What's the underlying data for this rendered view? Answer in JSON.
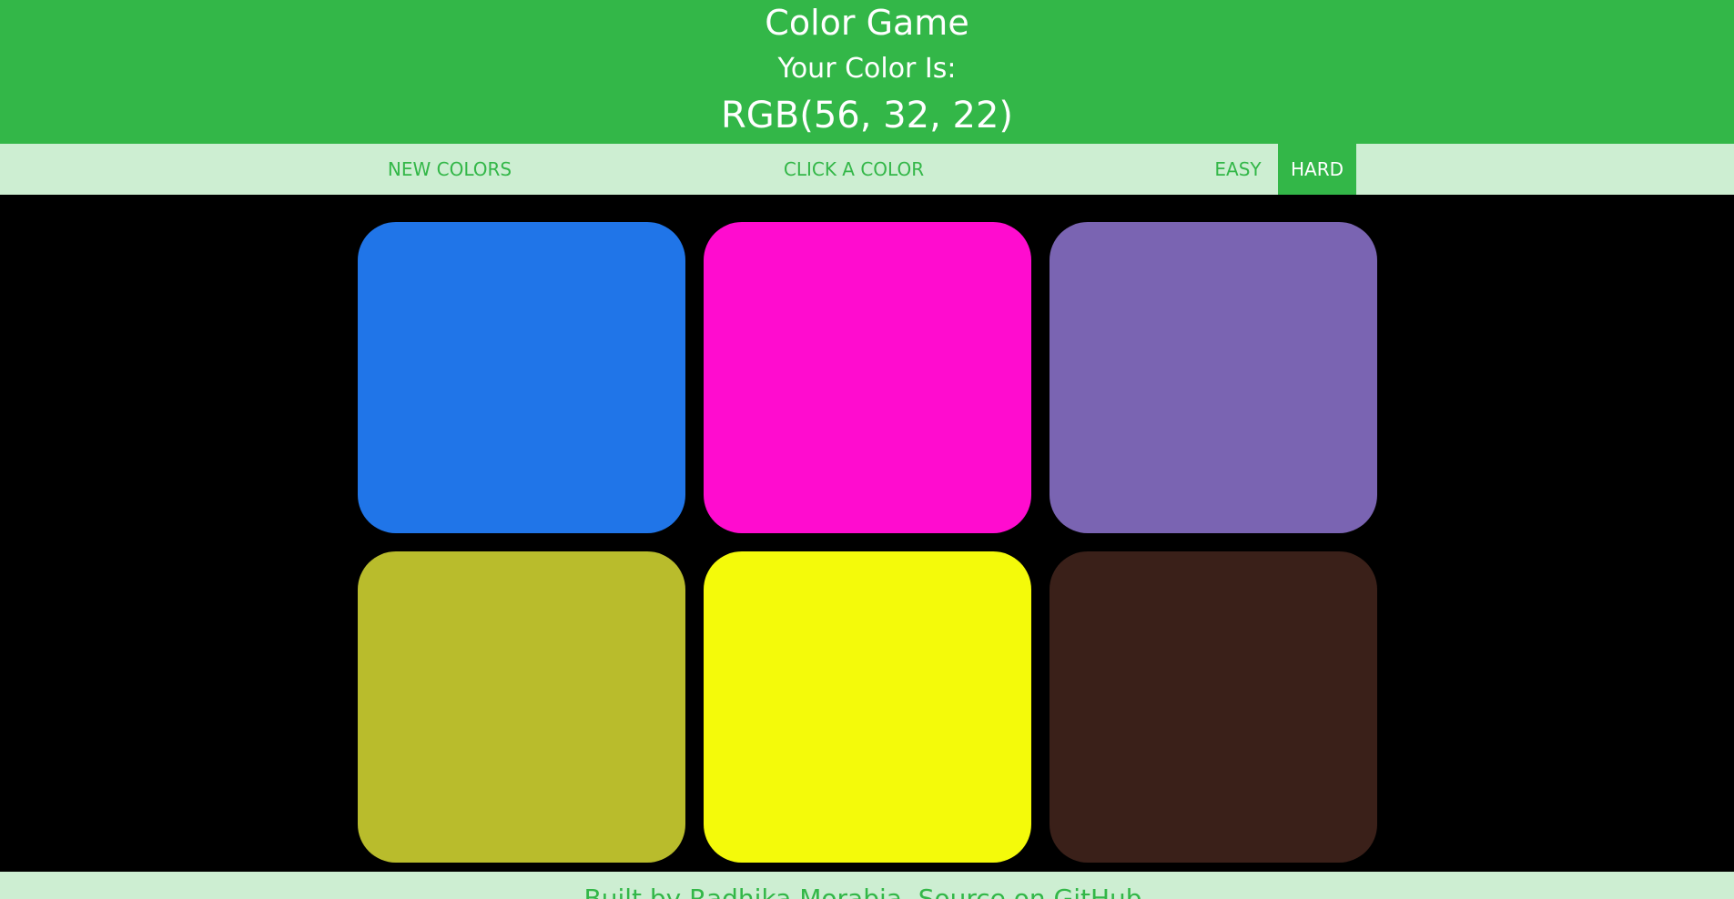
{
  "header": {
    "title": "Color Game",
    "subtitle": "Your Color Is:",
    "target_color": "RGB(56, 32, 22)"
  },
  "menu": {
    "new_colors_label": "NEW COLORS",
    "message": "CLICK A COLOR",
    "easy_label": "EASY",
    "hard_label": "HARD",
    "selected_mode": "HARD"
  },
  "squares": [
    {
      "color": "#2075e8"
    },
    {
      "color": "#ff0ccf"
    },
    {
      "color": "#7a64b2"
    },
    {
      "color": "#b9bc2c"
    },
    {
      "color": "#f4fa0a"
    },
    {
      "color": "#3a2019"
    }
  ],
  "footer": {
    "text": "Built by Radhika Morabia. Source on GitHub."
  },
  "colors": {
    "accent": "#33b748",
    "menu_background": "#cdeed2",
    "board_background": "#000000"
  }
}
